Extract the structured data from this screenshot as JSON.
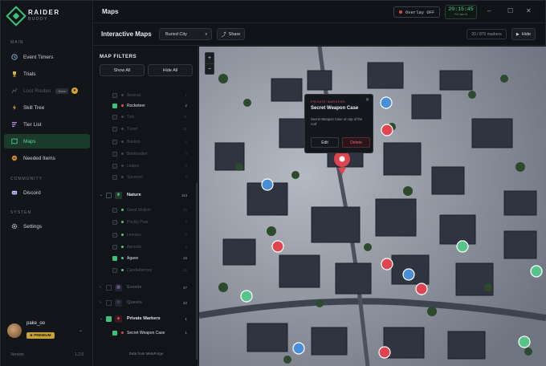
{
  "app": {
    "name": "RAIDER",
    "subname": "BUDDY",
    "window_title": "Maps"
  },
  "titlebar": {
    "overlay_label": "Overlay OFF",
    "clock_time": "20:15:45",
    "clock_date": "Fri Jun 8"
  },
  "sidebar": {
    "section_main": "MAIN",
    "section_community": "COMMUNITY",
    "section_system": "SYSTEM",
    "items": [
      {
        "label": "Event Timers",
        "icon": "clock-icon"
      },
      {
        "label": "Trials",
        "icon": "trophy-icon"
      },
      {
        "label": "Loot Routes",
        "icon": "route-icon",
        "tag": "Soon"
      },
      {
        "label": "Skill Tree",
        "icon": "skill-tree-icon"
      },
      {
        "label": "Tier List",
        "icon": "tier-list-icon"
      },
      {
        "label": "Maps",
        "icon": "map-icon",
        "active": true
      },
      {
        "label": "Needed Items",
        "icon": "box-icon"
      },
      {
        "label": "Discord",
        "icon": "discord-icon"
      },
      {
        "label": "Settings",
        "icon": "gear-icon"
      }
    ],
    "user": {
      "name": "pake_oo",
      "badge": "PREMIUM"
    },
    "version_label": "Version",
    "version_value": "1.2.0"
  },
  "toolbar": {
    "title": "Interactive Maps",
    "map_select": "Buried City",
    "share_label": "Share",
    "marker_count": "20 / 870 markers",
    "hide_label": "Hide"
  },
  "filters": {
    "title": "MAP FILTERS",
    "show_all": "Show All",
    "hide_all": "Hide All",
    "rows_top": [
      {
        "label": "Arsenal",
        "count": "1",
        "on": false
      },
      {
        "label": "Rocketeer",
        "count": "2",
        "on": true
      },
      {
        "label": "Tick",
        "count": "11",
        "on": false
      },
      {
        "label": "Turret",
        "count": "11",
        "on": false
      },
      {
        "label": "Bastion",
        "count": "2",
        "on": false
      },
      {
        "label": "Bombardier",
        "count": "4",
        "on": false
      },
      {
        "label": "Leaper",
        "count": "3",
        "on": false
      },
      {
        "label": "Surveyor",
        "count": "2",
        "on": false
      }
    ],
    "nature": {
      "label": "Nature",
      "count": "113"
    },
    "rows_nature": [
      {
        "label": "Great Mullein",
        "count": "20",
        "on": false
      },
      {
        "label": "Prickly Pear",
        "count": "6",
        "on": false
      },
      {
        "label": "Lemons",
        "count": "3",
        "on": false
      },
      {
        "label": "Apricots",
        "count": "5",
        "on": false
      },
      {
        "label": "Agave",
        "count": "16",
        "on": true
      },
      {
        "label": "Candleberries",
        "count": "12",
        "on": false
      }
    ],
    "events": {
      "label": "Events",
      "count": "47"
    },
    "quests": {
      "label": "Quests",
      "count": "22"
    },
    "private": {
      "label": "Private Markers",
      "count": "1"
    },
    "private_row": {
      "label": "Secret Weapon Case",
      "count": "1"
    },
    "source": "Data from MetaForge"
  },
  "popup": {
    "tag": "PRIVATE MARKERS",
    "title": "Secret Weapon Case",
    "desc": "Secret Weapon Case on top of the roof",
    "edit": "Edit",
    "delete": "Delete"
  },
  "colors": {
    "accent": "#3fbf7a",
    "danger": "#e0444f",
    "blue_marker": "#4a8fd6"
  }
}
